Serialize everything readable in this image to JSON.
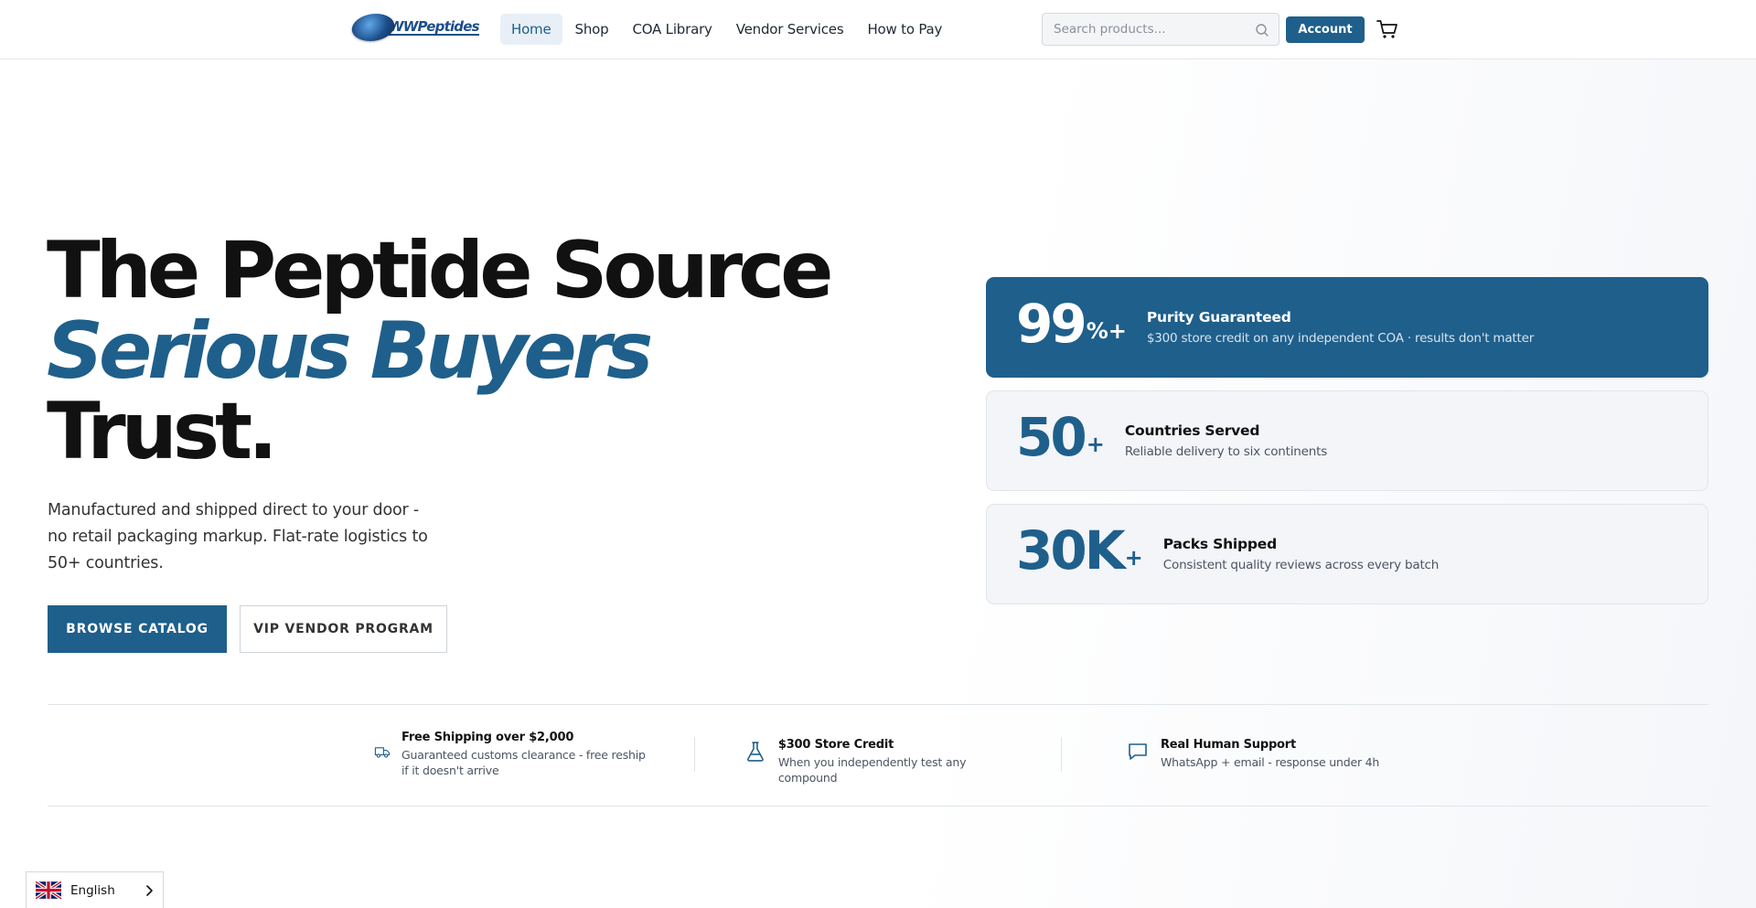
{
  "header": {
    "logo_text": "WWPeptides",
    "nav": [
      {
        "label": "Home",
        "active": true
      },
      {
        "label": "Shop"
      },
      {
        "label": "COA Library"
      },
      {
        "label": "Vendor Services"
      },
      {
        "label": "How to Pay"
      }
    ],
    "search": {
      "placeholder": "Search products..."
    },
    "account_label": "Account",
    "icons": {
      "search": "search-icon",
      "cart": "cart-icon"
    }
  },
  "hero": {
    "title_line1": "The Peptide Source",
    "title_line2": "Serious Buyers",
    "title_line3": "Trust.",
    "subtitle": "Manufactured and shipped direct to your door - no retail packaging markup. Flat-rate logistics to 50+ countries.",
    "primary_button": "BROWSE CATALOG",
    "secondary_button": "VIP VENDOR PROGRAM"
  },
  "stats": [
    {
      "number": "99",
      "suffix": "%+",
      "title": "Purity Guaranteed",
      "description": "$300 store credit on any independent COA · results don't matter"
    },
    {
      "number": "50",
      "suffix": "+",
      "title": "Countries Served",
      "description": "Reliable delivery to six continents"
    },
    {
      "number": "30K",
      "suffix": "+",
      "title": "Packs Shipped",
      "description": "Consistent quality reviews across every batch"
    }
  ],
  "features": [
    {
      "icon": "truck-icon",
      "title": "Free Shipping over $2,000",
      "description": "Guaranteed customs clearance - free reship if it doesn't arrive"
    },
    {
      "icon": "flask-icon",
      "title": "$300 Store Credit",
      "description": "When you independently test any compound"
    },
    {
      "icon": "chat-icon",
      "title": "Real Human Support",
      "description": "WhatsApp + email - response under 4h"
    }
  ],
  "language": {
    "label": "English",
    "flag": "uk-flag-icon"
  },
  "colors": {
    "brand": "#1f5f8b",
    "brand_light": "#e8eff6",
    "text": "#111111",
    "muted": "#4b5563"
  }
}
